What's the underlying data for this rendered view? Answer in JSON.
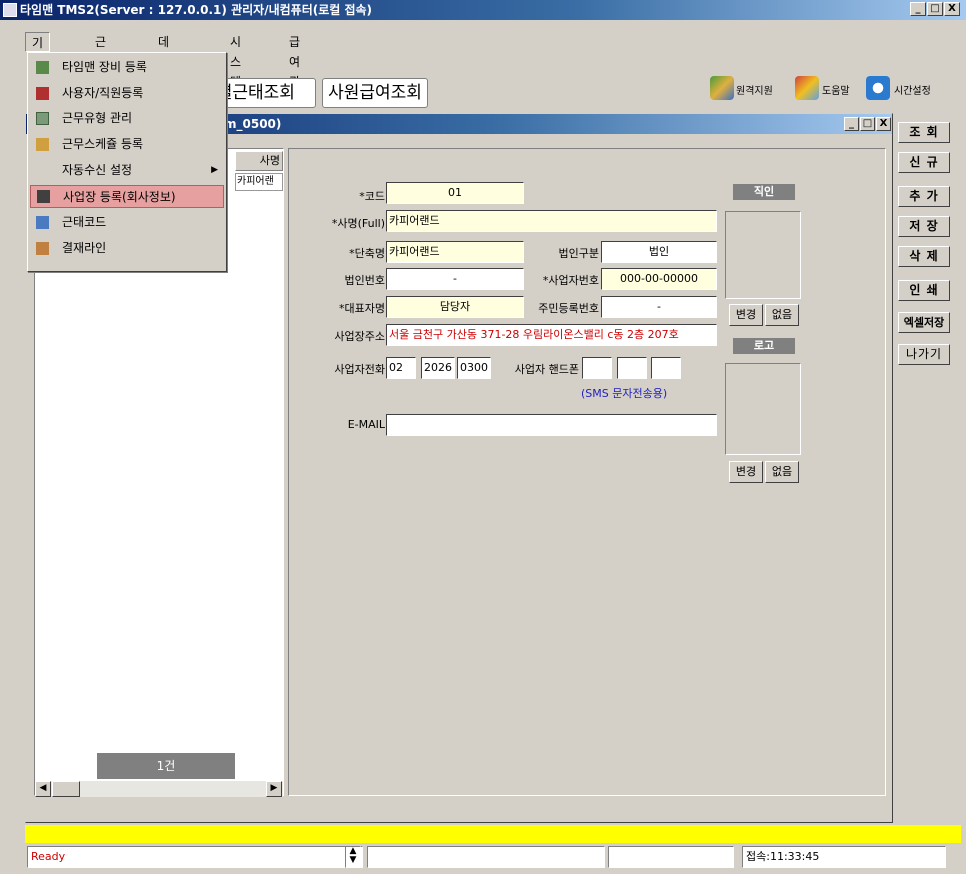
{
  "window": {
    "title": "타임맨 TMS2(Server : 127.0.0.1) 관리자/내컴퓨터(로컬 접속)",
    "min": "_",
    "max": "□",
    "close": "X"
  },
  "menubar": [
    "기본설정",
    "근태관리",
    "데이터관리",
    "시스템",
    "급여관리"
  ],
  "dropdown": [
    {
      "label": "타임맨 장비 등록",
      "icon": "device-icon"
    },
    {
      "label": "사용자/직원등록",
      "icon": "user-icon"
    },
    {
      "label": "근무유형 관리",
      "icon": "grid-icon"
    },
    {
      "label": "근무스케쥴 등록",
      "icon": "calendar-icon"
    },
    {
      "label": "자동수신 설정",
      "icon": "",
      "submenu": "▶"
    },
    {
      "label": "사업장 등록(회사정보)",
      "icon": "building-icon",
      "selected": true
    },
    {
      "label": "근태코드",
      "icon": "tree-icon"
    },
    {
      "label": "결재라인",
      "icon": "approval-icon"
    }
  ],
  "toolbar": {
    "buttons": [
      "월별근태조회",
      "사원급여조회"
    ],
    "remote_support": "원격지원",
    "help": "도움말",
    "time_setting": "시간설정"
  },
  "sidebuttons": [
    "조 회",
    "신 규",
    "추 가",
    "저 장",
    "삭 제",
    "인 쇄",
    "엑셀저장",
    "나가기"
  ],
  "child": {
    "title": "m_0500)"
  },
  "list": {
    "header": "사명",
    "cell": "카피어랜",
    "count": "1건"
  },
  "form": {
    "code_label": "*코드",
    "code": "01",
    "fullname_label": "*사명(Full)",
    "fullname": "카피어랜드",
    "short_label": "*단축명",
    "short": "카피어랜드",
    "corptype_label": "법인구분",
    "corptype": "법인",
    "corpno_label": "법인번호",
    "corpno": "-",
    "bizno_label": "*사업자번호",
    "bizno": "000-00-00000",
    "ceo_label": "*대표자명",
    "ceo": "담당자",
    "idno_label": "주민등록번호",
    "idno": "-",
    "addr_label": "사업장주소",
    "addr": "서울 금천구 가산동 371-28 우림라이온스밸리 c동 2층 207호",
    "tel_label": "사업자전화",
    "tel1": "02",
    "tel2": "2026",
    "tel3": "0300",
    "mobile_label": "사업자 핸드폰",
    "mobile1": "",
    "mobile2": "",
    "mobile3": "",
    "sms_note": "(SMS 문자전송용)",
    "email_label": "E-MAIL",
    "email": ""
  },
  "seal": {
    "title": "직인",
    "change": "변경",
    "none": "없음"
  },
  "logo": {
    "title": "로고",
    "change": "변경",
    "none": "없음"
  },
  "statusbar": {
    "ready": "Ready",
    "time": "접속:11:33:45"
  },
  "colors": {
    "title_blue": "#0a246a",
    "status_yellow": "#ffff00",
    "selected_menu": "#e7a0a0",
    "address_red": "#cc0000",
    "sms_blue": "#2020c0"
  }
}
